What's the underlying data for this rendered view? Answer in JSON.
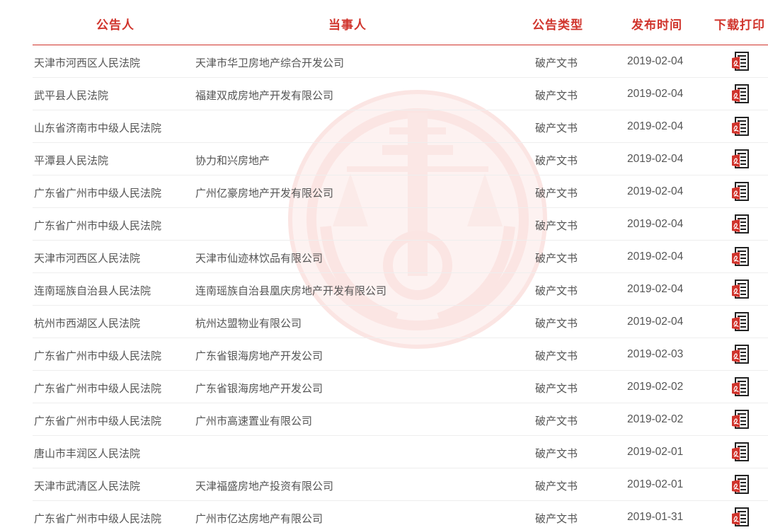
{
  "header": {
    "col_notifier": "公告人",
    "col_party": "当事人",
    "col_type": "公告类型",
    "col_date": "发布时间",
    "col_download": "下载打印"
  },
  "icon_names": {
    "download": "pdf-download-icon",
    "watermark": "court-emblem-watermark"
  },
  "colors": {
    "accent": "#d0342c",
    "text": "#555555"
  },
  "rows": [
    {
      "court": "天津市河西区人民法院",
      "party": "天津市华卫房地产综合开发公司",
      "type": "破产文书",
      "date": "2019-02-04"
    },
    {
      "court": "武平县人民法院",
      "party": "福建双成房地产开发有限公司",
      "type": "破产文书",
      "date": "2019-02-04"
    },
    {
      "court": "山东省济南市中级人民法院",
      "party": "",
      "type": "破产文书",
      "date": "2019-02-04"
    },
    {
      "court": "平潭县人民法院",
      "party": "协力和兴房地产",
      "type": "破产文书",
      "date": "2019-02-04"
    },
    {
      "court": "广东省广州市中级人民法院",
      "party": "广州亿豪房地产开发有限公司",
      "type": "破产文书",
      "date": "2019-02-04"
    },
    {
      "court": "广东省广州市中级人民法院",
      "party": "",
      "type": "破产文书",
      "date": "2019-02-04"
    },
    {
      "court": "天津市河西区人民法院",
      "party": "天津市仙迹林饮品有限公司",
      "type": "破产文书",
      "date": "2019-02-04"
    },
    {
      "court": "连南瑶族自治县人民法院",
      "party": "连南瑶族自治县凰庆房地产开发有限公司",
      "type": "破产文书",
      "date": "2019-02-04"
    },
    {
      "court": "杭州市西湖区人民法院",
      "party": "杭州达盟物业有限公司",
      "type": "破产文书",
      "date": "2019-02-04"
    },
    {
      "court": "广东省广州市中级人民法院",
      "party": "广东省银海房地产开发公司",
      "type": "破产文书",
      "date": "2019-02-03"
    },
    {
      "court": "广东省广州市中级人民法院",
      "party": "广东省银海房地产开发公司",
      "type": "破产文书",
      "date": "2019-02-02"
    },
    {
      "court": "广东省广州市中级人民法院",
      "party": "广州市高速置业有限公司",
      "type": "破产文书",
      "date": "2019-02-02"
    },
    {
      "court": "唐山市丰润区人民法院",
      "party": "",
      "type": "破产文书",
      "date": "2019-02-01"
    },
    {
      "court": "天津市武清区人民法院",
      "party": "天津福盛房地产投资有限公司",
      "type": "破产文书",
      "date": "2019-02-01"
    },
    {
      "court": "广东省广州市中级人民法院",
      "party": "广州市亿达房地产有限公司",
      "type": "破产文书",
      "date": "2019-01-31"
    }
  ]
}
